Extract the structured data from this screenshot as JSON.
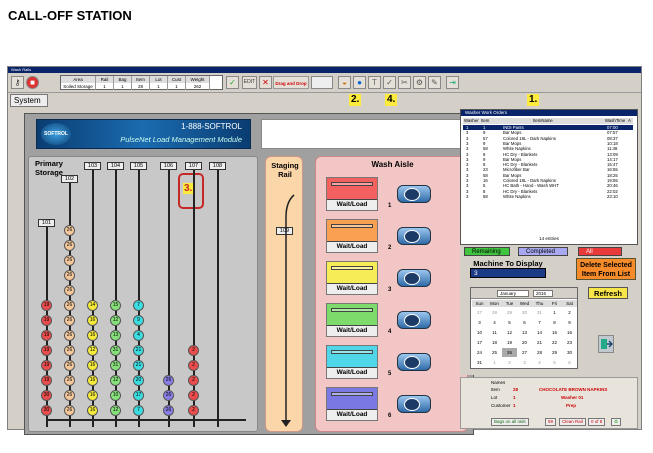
{
  "page_title": "CALL-OFF STATION",
  "window": {
    "title": "Wash Rails"
  },
  "toolbar": {
    "filter_headers": [
      "Area",
      "Rail",
      "Bag",
      "Item",
      "Lot",
      "Cust",
      "Weight"
    ],
    "filter_values": [
      "Soiled Storage",
      "1",
      "1",
      "28",
      "1",
      "1",
      "262"
    ],
    "edit_label": "EDIT",
    "drag_drop_label": "Drag and Drop"
  },
  "system_tab": "System",
  "callouts": [
    "1.",
    "2.",
    "3.",
    "4."
  ],
  "banner": {
    "phone": "1-888-SOFTROL",
    "module": "PulseNet Load Management Module",
    "logo_text": "SOFTROL"
  },
  "primary_storage": {
    "label": "Primary Storage",
    "rails": [
      {
        "label": "101",
        "balls": [
          "19",
          "19",
          "19",
          "19",
          "19",
          "19",
          "30",
          "30"
        ],
        "color": "#e84c4c"
      },
      {
        "label": "102",
        "balls": [
          "26",
          "26",
          "26",
          "26",
          "26",
          "26",
          "26",
          "26",
          "26",
          "26",
          "26",
          "26",
          "26"
        ],
        "color": "#f4c89a"
      },
      {
        "label": "103",
        "balls": [
          "14",
          "16",
          "16",
          "12",
          "16",
          "16",
          "16",
          "16"
        ],
        "color": "#f3ea3a"
      },
      {
        "label": "104",
        "balls": [
          "15",
          "12",
          "13",
          "31",
          "31",
          "12",
          "10",
          "12"
        ],
        "color": "#86e07a"
      },
      {
        "label": "105",
        "balls": [
          "7",
          "9",
          "4",
          "21",
          "21",
          "20",
          "17",
          "7"
        ],
        "color": "#3bdde0"
      },
      {
        "label": "106",
        "balls": [
          "26",
          "26",
          "26"
        ],
        "color": "#8a7ee6"
      },
      {
        "label": "107",
        "balls": [
          "2",
          "2",
          "2",
          "2",
          "2"
        ],
        "color": "#e84c4c"
      },
      {
        "label": "108",
        "balls": [],
        "color": "#e84c4c"
      }
    ]
  },
  "staging": {
    "label": "Staging Rail",
    "rail_label": "109"
  },
  "wash_aisle": {
    "label": "Wash Aisle",
    "machines": [
      {
        "num": "1",
        "slot_label": "Wait/Load",
        "color": "#f36060"
      },
      {
        "num": "2",
        "slot_label": "Wait/Load",
        "color": "#f9a052"
      },
      {
        "num": "3",
        "slot_label": "Wait/Load",
        "color": "#f6ec56"
      },
      {
        "num": "4",
        "slot_label": "Wait/Load",
        "color": "#7cdb6a"
      },
      {
        "num": "5",
        "slot_label": "Wait/Load",
        "color": "#4fd6e8"
      },
      {
        "num": "6",
        "slot_label": "Wait/Load",
        "color": "#7a78e2"
      }
    ]
  },
  "orders": {
    "title": "Washer Work Orders",
    "headers": [
      "Washer",
      "Item",
      "ItemName",
      "WashTime",
      "A"
    ],
    "rows": [
      [
        "1",
        "1",
        "INDI Pants",
        "07:00"
      ],
      [
        "3",
        "9",
        "Bar Mops",
        "07:57"
      ],
      [
        "3",
        "57",
        "Colored 18L - Dark Napkins",
        "08:37"
      ],
      [
        "3",
        "9",
        "Bar Mops",
        "10:18"
      ],
      [
        "3",
        "58",
        "White Napkins",
        "11:48"
      ],
      [
        "3",
        "8",
        "HC Dry - Blankets",
        "13:09"
      ],
      [
        "3",
        "9",
        "Bar Mops",
        "14:17"
      ],
      [
        "3",
        "8",
        "HC Dry - Blankets",
        "15:47"
      ],
      [
        "3",
        "23",
        "Microfiber Bar",
        "16:55"
      ],
      [
        "3",
        "58",
        "Bar Mops",
        "18:25"
      ],
      [
        "3",
        "16",
        "Colored 18L - Dark Napkins",
        "19:55"
      ],
      [
        "3",
        "5",
        "HC Bath - Hand - Wash WHT",
        "20:46"
      ],
      [
        "3",
        "8",
        "HC Dry - Blankets",
        "22:02"
      ],
      [
        "3",
        "58",
        "White Napkins",
        "23:10"
      ]
    ],
    "entries": "14 entries"
  },
  "filters": [
    {
      "label": "Remaining",
      "color": "#3ec43e"
    },
    {
      "label": "Completed",
      "color": "#a8a8f0"
    },
    {
      "label": "All",
      "color": "#e83a3a"
    }
  ],
  "machine_to_display": {
    "label": "Machine To Display",
    "value": "3"
  },
  "delete_button": "Delete Selected Item From List",
  "refresh_button": "Refresh",
  "calendar": {
    "month": "January",
    "year": "2016",
    "days": [
      "Sun",
      "Mon",
      "Tue",
      "Wed",
      "Thu",
      "Fri",
      "Sat"
    ],
    "dates": [
      "27",
      "28",
      "29",
      "30",
      "31",
      "1",
      "2",
      "3",
      "4",
      "5",
      "6",
      "7",
      "8",
      "9",
      "10",
      "11",
      "12",
      "13",
      "14",
      "15",
      "16",
      "17",
      "18",
      "19",
      "20",
      "21",
      "22",
      "23",
      "24",
      "25",
      "26",
      "27",
      "28",
      "29",
      "30",
      "31",
      "1",
      "2",
      "3",
      "4",
      "5",
      "6"
    ],
    "today_index": 30
  },
  "info": {
    "name_label": "Names",
    "item_label": "Item",
    "item_num": "28",
    "item_name": "CHOCOLATE BROWN NAPKINS",
    "lot_label": "Lot",
    "lot_num": "1",
    "lot_name": "Washer 01",
    "cust_label": "Customer",
    "cust_num": "1",
    "cust_name": "Prep",
    "bags_label": "Bags on all rails",
    "bags_value": "59",
    "clean_label": "Clean Rail",
    "clean_value": "0 of 8"
  }
}
